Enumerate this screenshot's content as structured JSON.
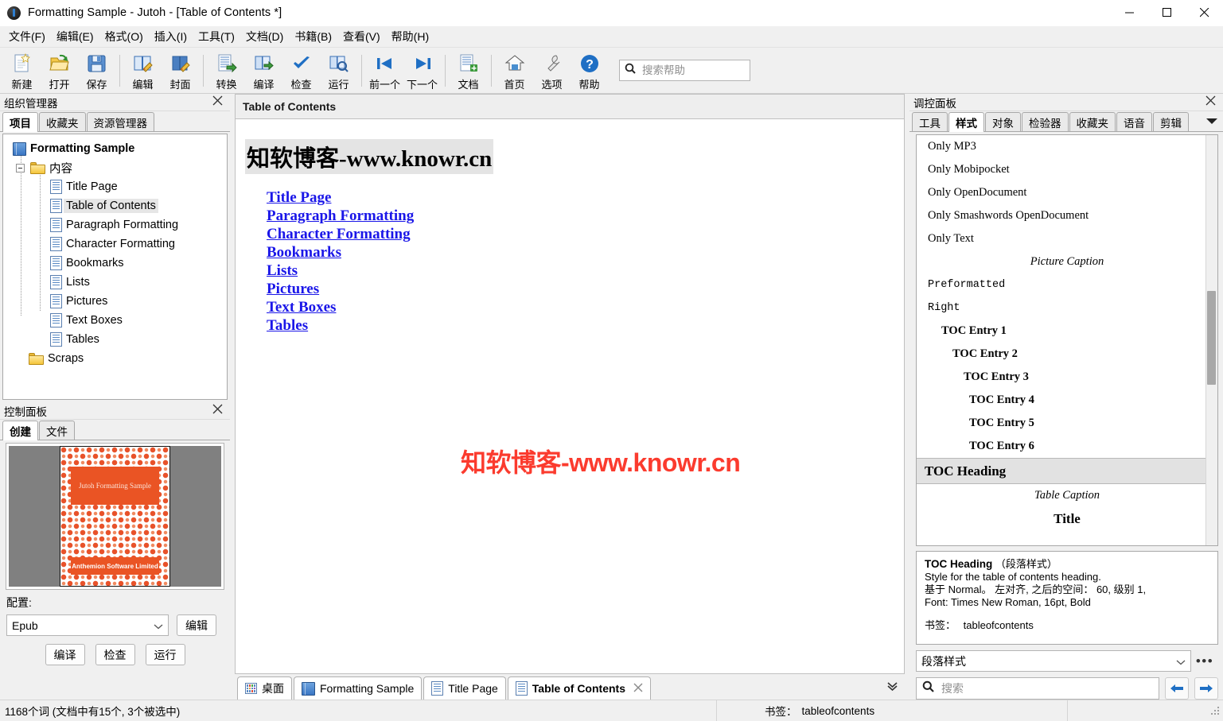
{
  "window": {
    "title": "Formatting Sample - Jutoh - [Table of Contents *]",
    "app_icon": "jutoh-icon",
    "minimize": "minimize-icon",
    "maximize": "maximize-icon",
    "close": "close-icon"
  },
  "menubar": [
    {
      "label": "文件(F)"
    },
    {
      "label": "编辑(E)"
    },
    {
      "label": "格式(O)"
    },
    {
      "label": "插入(I)"
    },
    {
      "label": "工具(T)"
    },
    {
      "label": "文档(D)"
    },
    {
      "label": "书籍(B)"
    },
    {
      "label": "查看(V)"
    },
    {
      "label": "帮助(H)"
    }
  ],
  "toolbar": {
    "buttons": [
      {
        "label": "新建",
        "icon": "new-document-icon"
      },
      {
        "label": "打开",
        "icon": "open-folder-icon"
      },
      {
        "label": "保存",
        "icon": "save-disk-icon"
      },
      {
        "label": "编辑",
        "icon": "edit-book-icon"
      },
      {
        "label": "封面",
        "icon": "cover-book-icon"
      },
      {
        "label": "转换",
        "icon": "convert-icon"
      },
      {
        "label": "编译",
        "icon": "compile-icon"
      },
      {
        "label": "检查",
        "icon": "check-icon"
      },
      {
        "label": "运行",
        "icon": "run-icon"
      },
      {
        "label": "前一个",
        "icon": "previous-icon"
      },
      {
        "label": "下一个",
        "icon": "next-icon"
      },
      {
        "label": "文档",
        "icon": "add-document-icon"
      },
      {
        "label": "首页",
        "icon": "home-icon"
      },
      {
        "label": "选项",
        "icon": "wrench-options-icon"
      },
      {
        "label": "帮助",
        "icon": "help-question-icon"
      }
    ],
    "search": {
      "placeholder": "搜索帮助",
      "value": "",
      "icon": "search-icon"
    }
  },
  "organizer": {
    "title": "组织管理器",
    "close_icon": "close-icon",
    "tabs": [
      {
        "label": "项目",
        "active": true
      },
      {
        "label": "收藏夹",
        "active": false
      },
      {
        "label": "资源管理器",
        "active": false
      }
    ],
    "tree": [
      {
        "label": "Formatting Sample",
        "icon": "book-icon",
        "level": 0,
        "selected": false
      },
      {
        "label": "内容",
        "icon": "folder-icon",
        "level": 1,
        "selected": false
      },
      {
        "label": "Title Page",
        "icon": "document-icon",
        "level": 2,
        "selected": false
      },
      {
        "label": "Table of Contents",
        "icon": "document-icon",
        "level": 2,
        "selected": true
      },
      {
        "label": "Paragraph Formatting",
        "icon": "document-icon",
        "level": 2,
        "selected": false
      },
      {
        "label": "Character Formatting",
        "icon": "document-icon",
        "level": 2,
        "selected": false
      },
      {
        "label": "Bookmarks",
        "icon": "document-icon",
        "level": 2,
        "selected": false
      },
      {
        "label": "Lists",
        "icon": "document-icon",
        "level": 2,
        "selected": false
      },
      {
        "label": "Pictures",
        "icon": "document-icon",
        "level": 2,
        "selected": false
      },
      {
        "label": "Text Boxes",
        "icon": "document-icon",
        "level": 2,
        "selected": false
      },
      {
        "label": "Tables",
        "icon": "document-icon",
        "level": 2,
        "selected": false
      },
      {
        "label": "Scraps",
        "icon": "folder-icon",
        "level": 1,
        "selected": false
      }
    ]
  },
  "control_panel": {
    "title": "控制面板",
    "close_icon": "close-icon",
    "tabs": [
      {
        "label": "创建",
        "active": true
      },
      {
        "label": "文件",
        "active": false
      }
    ],
    "cover": {
      "title_text": "Jutoh Formatting Sample",
      "publisher_text": "Anthemion Software Limited"
    },
    "config_label": "配置:",
    "config_value": "Epub",
    "edit_button": "编辑",
    "actions": [
      {
        "label": "编译"
      },
      {
        "label": "检查"
      },
      {
        "label": "运行"
      }
    ]
  },
  "document": {
    "header_title": "Table of Contents",
    "title": "知软博客-www.knowr.cn",
    "watermark": "知软博客-www.knowr.cn",
    "links": [
      {
        "label": "Title Page"
      },
      {
        "label": "Paragraph Formatting"
      },
      {
        "label": "Character Formatting"
      },
      {
        "label": "Bookmarks"
      },
      {
        "label": "Lists"
      },
      {
        "label": "Pictures"
      },
      {
        "label": "Text Boxes"
      },
      {
        "label": "Tables"
      }
    ]
  },
  "doc_tabs": {
    "items": [
      {
        "label": "桌面",
        "icon": "desktop-icon",
        "active": false,
        "closable": false
      },
      {
        "label": "Formatting Sample",
        "icon": "book-icon",
        "active": false,
        "closable": false
      },
      {
        "label": "Title Page",
        "icon": "document-icon",
        "active": false,
        "closable": false
      },
      {
        "label": "Table of Contents",
        "icon": "document-icon",
        "active": true,
        "closable": true
      }
    ],
    "close_icon": "close-icon",
    "overflow_icon": "chevron-down-icon"
  },
  "inspector": {
    "title": "调控面板",
    "close_icon": "close-icon",
    "tabs": [
      {
        "label": "工具",
        "active": false
      },
      {
        "label": "样式",
        "active": true
      },
      {
        "label": "对象",
        "active": false
      },
      {
        "label": "检验器",
        "active": false
      },
      {
        "label": "收藏夹",
        "active": false
      },
      {
        "label": "语音",
        "active": false
      },
      {
        "label": "剪辑",
        "active": false
      }
    ],
    "overflow_icon": "chevron-down-icon",
    "styles": [
      {
        "label": "Only MP3",
        "variant": "normal"
      },
      {
        "label": "Only Mobipocket",
        "variant": "normal"
      },
      {
        "label": "Only OpenDocument",
        "variant": "normal"
      },
      {
        "label": "Only Smashwords OpenDocument",
        "variant": "normal"
      },
      {
        "label": "Only Text",
        "variant": "normal"
      },
      {
        "label": "Picture Caption",
        "variant": "center-italic"
      },
      {
        "label": "Preformatted",
        "variant": "mono"
      },
      {
        "label": "Right",
        "variant": "mono"
      },
      {
        "label": "TOC Entry 1",
        "variant": "bold-i1"
      },
      {
        "label": "TOC Entry 2",
        "variant": "bold-i2"
      },
      {
        "label": "TOC Entry 3",
        "variant": "bold-i3"
      },
      {
        "label": "TOC Entry 4",
        "variant": "bold-i4"
      },
      {
        "label": "TOC Entry 5",
        "variant": "bold-i5"
      },
      {
        "label": "TOC Entry 6",
        "variant": "bold-i6"
      },
      {
        "label": "TOC Heading",
        "variant": "selected"
      },
      {
        "label": "Table Caption",
        "variant": "center-italic"
      },
      {
        "label": "Title",
        "variant": "center-big"
      }
    ],
    "description": {
      "name": "TOC Heading",
      "kind": "（段落样式）",
      "summary": "Style for the table of contents heading.",
      "based_on": "基于 Normal。 左对齐, 之后的空间： 60, 级别 1,",
      "font": "Font: Times New Roman, 16pt, Bold",
      "bookmark_label": "书签：",
      "bookmark_value": "tableofcontents"
    },
    "style_kind_select": "段落样式",
    "more_icon": "more-dots-icon",
    "search": {
      "placeholder": "搜索",
      "value": "",
      "icon": "search-icon"
    },
    "back_icon": "arrow-left-icon",
    "forward_icon": "arrow-right-icon"
  },
  "statusbar": {
    "word_count": "1168个词 (文档中有15个, 3个被选中)",
    "bookmark_label": "书签：",
    "bookmark_value": "tableofcontents"
  },
  "colors": {
    "link": "#1a16e8",
    "watermark": "#fb3b2e",
    "accent_blue": "#1f6fc4",
    "cover_orange": "#ea5424"
  }
}
